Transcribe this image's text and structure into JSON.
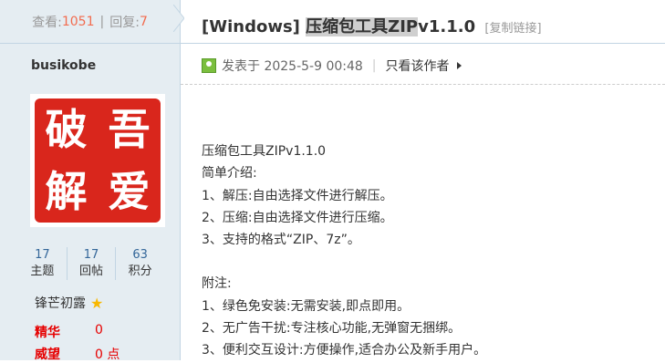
{
  "sidebar": {
    "views_label": "查看:",
    "views_count": "1051",
    "separator": "|",
    "replies_label": "回复:",
    "replies_count": "7",
    "username": "busikobe",
    "avatar_chars": [
      "破",
      "吾",
      "解",
      "爱"
    ],
    "stats": [
      {
        "value": "17",
        "label": "主题"
      },
      {
        "value": "17",
        "label": "回帖"
      },
      {
        "value": "63",
        "label": "积分"
      }
    ],
    "rank": "锋芒初露",
    "rank_icon": "star-icon",
    "jinghua_label": "精华",
    "jinghua_value": "0",
    "weiwang_label": "威望",
    "weiwang_value": "0 点"
  },
  "post": {
    "title_prefix": "[Windows] ",
    "title_highlight": "压缩包工具ZIP",
    "title_suffix": "v1.1.0",
    "copy_link": "[复制链接]",
    "posted": "发表于 2025-5-9 00:48",
    "meta_sep": "|",
    "author_only": "只看该作者",
    "content_lines_1": [
      "压缩包工具ZIPv1.1.0",
      "简单介绍:",
      "1、解压:自由选择文件进行解压。",
      "2、压缩:自由选择文件进行压缩。",
      "3、支持的格式“ZIP、7z”。"
    ],
    "content_lines_2": [
      "附注:",
      "1、绿色免安装:无需安装,即点即用。",
      "2、无广告干扰:专注核心功能,无弹窗无捆绑。",
      "3、便利交互设计:方便操作,适合办公及新手用户。"
    ]
  },
  "colors": {
    "accent": "#f26c4f",
    "sidebar_bg": "#e5edf2",
    "link": "#369",
    "red": "#e60000",
    "seal": "#d9261c"
  }
}
